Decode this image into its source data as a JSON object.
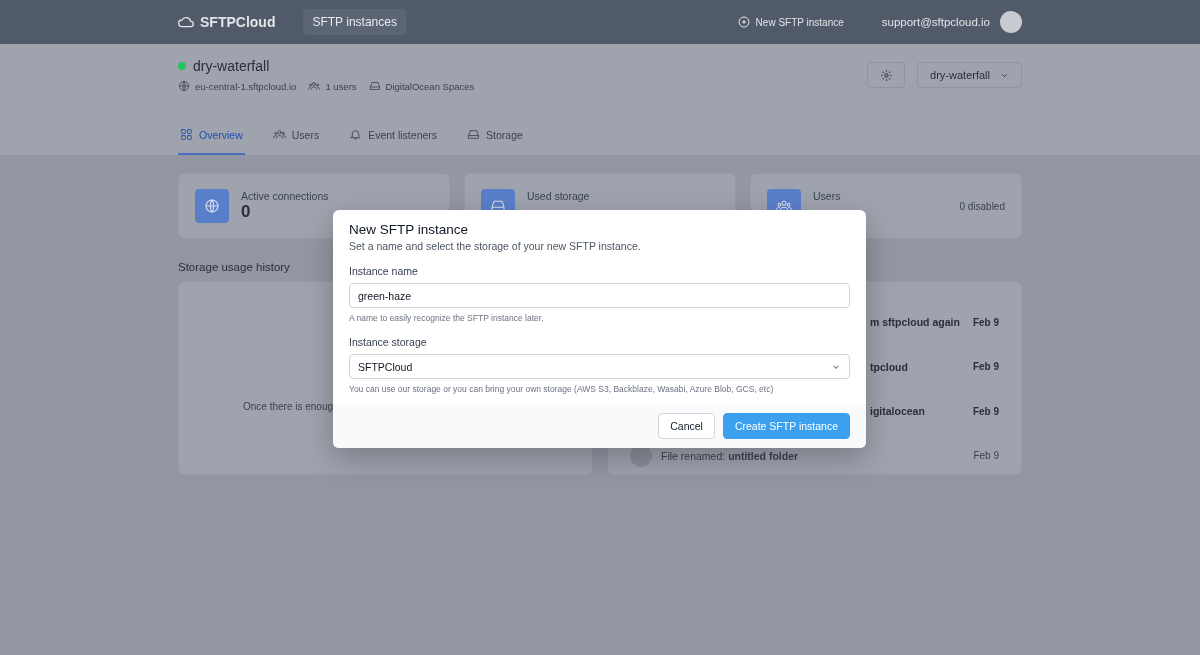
{
  "navbar": {
    "logo": "SFTPCloud",
    "nav_items": [
      {
        "label": "SFTP instances",
        "selected": true
      }
    ],
    "new_instance": "New SFTP instance",
    "email": "support@sftpcloud.io"
  },
  "instance": {
    "name": "dry-waterfall",
    "online": true,
    "host": "eu-central-1.sftpcloud.io",
    "users": "1 users",
    "storage": "DigitalOcean Spaces",
    "switcher": "dry-waterfall"
  },
  "tabs": [
    {
      "label": "Overview",
      "selected": true
    },
    {
      "label": "Users",
      "selected": false
    },
    {
      "label": "Event listeners",
      "selected": false
    },
    {
      "label": "Storage",
      "selected": false
    }
  ],
  "stats": [
    {
      "label": "Active connections",
      "value": "0"
    },
    {
      "label": "Used storage"
    },
    {
      "label": "Users",
      "note": "0 disabled"
    }
  ],
  "storage_history": {
    "title": "Storage usage history",
    "empty_text": "Once there is enoug"
  },
  "events": [
    {
      "kind": "clipped",
      "text": "m sftpcloud again",
      "date": "Feb 9"
    },
    {
      "kind": "clipped",
      "text": "tpcloud",
      "date": "Feb 9"
    },
    {
      "kind": "clipped",
      "text": "igitalocean",
      "date": "Feb 9"
    },
    {
      "kind": "full",
      "text": "File renamed: **untitled folder**",
      "date": "Feb 9"
    }
  ],
  "modal": {
    "title": "New SFTP instance",
    "subtitle": "Set a name and select the storage of your new SFTP instance.",
    "name_label": "Instance name",
    "name_value": "green-haze",
    "name_help": "A name to easily recognize the SFTP instance later.",
    "storage_label": "Instance storage",
    "storage_value": "SFTPCloud",
    "storage_help": "You can use our storage or you can bring your own storage (AWS S3, Backblaze, Wasabi, Azure Blob, GCS, etc)",
    "buttons": [
      {
        "label": "Cancel",
        "kind": "secondary"
      },
      {
        "label": "Create SFTP instance",
        "kind": "primary"
      }
    ]
  }
}
